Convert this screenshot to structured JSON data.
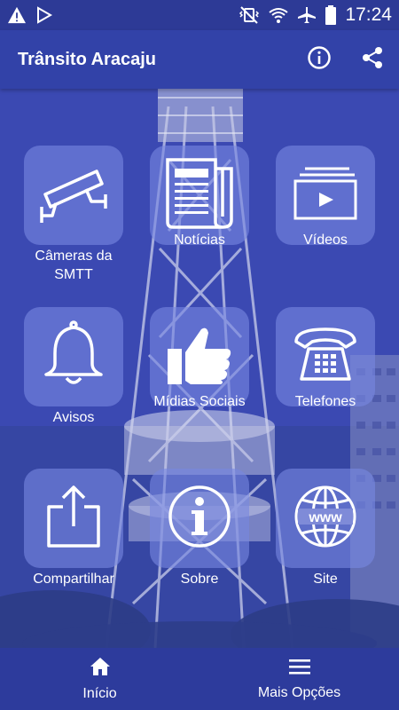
{
  "status_bar": {
    "time": "17:24",
    "icons": [
      "warning-icon",
      "play-store-icon",
      "vibrate-icon",
      "wifi-icon",
      "airplane-icon",
      "battery-icon"
    ]
  },
  "app_bar": {
    "title": "Trânsito Aracaju",
    "actions": [
      "info-icon",
      "share-icon"
    ]
  },
  "tiles": [
    {
      "label": "Câmeras da SMTT",
      "icon": "cctv-camera-icon"
    },
    {
      "label": "Notícias",
      "icon": "newspaper-icon"
    },
    {
      "label": "Vídeos",
      "icon": "video-icon"
    },
    {
      "label": "Avisos",
      "icon": "bell-icon"
    },
    {
      "label": "Mídias Sociais",
      "icon": "thumbs-up-icon"
    },
    {
      "label": "Telefones",
      "icon": "telephone-icon"
    },
    {
      "label": "Compartilhar",
      "icon": "share-export-icon"
    },
    {
      "label": "Sobre",
      "icon": "info-icon"
    },
    {
      "label": "Site",
      "icon": "www-globe-icon"
    }
  ],
  "bottom_nav": {
    "items": [
      {
        "label": "Início",
        "icon": "home-icon",
        "selected": true
      },
      {
        "label": "Mais Opções",
        "icon": "menu-icon",
        "selected": false
      }
    ]
  },
  "colors": {
    "app_bar": "#3242a8",
    "status_bar": "#2d3a96",
    "bottom_nav": "#2d3b9c",
    "tile": "#7887e1"
  }
}
